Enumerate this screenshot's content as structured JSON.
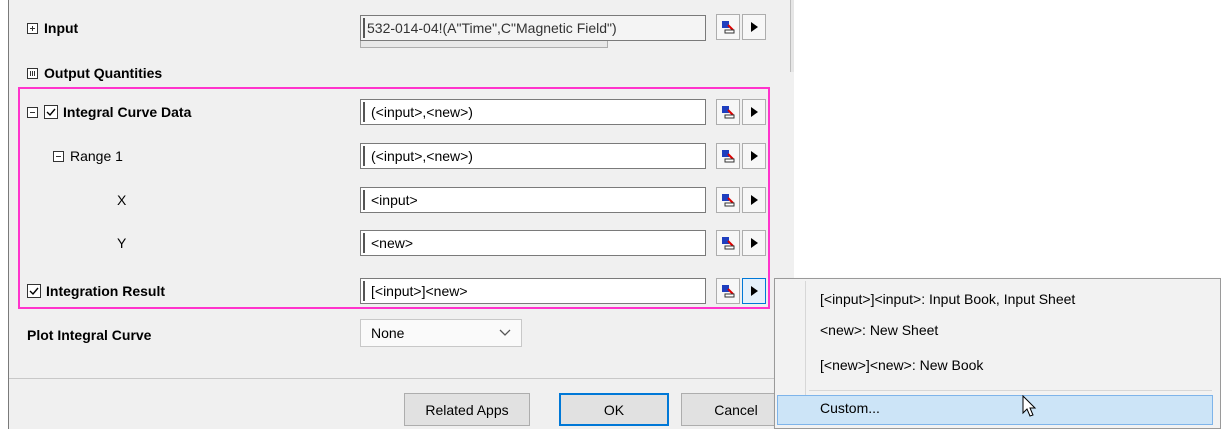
{
  "rows": {
    "input": {
      "label": "Input",
      "value": "532-014-04!(A\"Time\",C\"Magnetic Field\")"
    },
    "output_quantities": {
      "label": "Output Quantities"
    },
    "integral_curve": {
      "label": "Integral Curve Data",
      "value": "(<input>,<new>)",
      "checked": true
    },
    "range1": {
      "label": "Range 1",
      "value": "(<input>,<new>)"
    },
    "x": {
      "label": "X",
      "value": "<input>"
    },
    "y": {
      "label": "Y",
      "value": "<new>"
    },
    "integration_result": {
      "label": "Integration Result",
      "value": "[<input>]<new>",
      "checked": true
    },
    "plot_integral_curve": {
      "label": "Plot Integral Curve",
      "value": "None"
    }
  },
  "buttons": {
    "related_apps": "Related Apps",
    "ok": "OK",
    "cancel": "Cancel"
  },
  "menu": {
    "items": [
      "[<input>]<input>: Input Book, Input Sheet",
      "<new>: New Sheet",
      "[<new>]<new>: New Book",
      "Custom..."
    ],
    "highlighted_index": 3
  },
  "icons": {
    "expand": "plus-box-icon",
    "collapse": "minus-box-icon",
    "checkbox": "checkmark-icon",
    "select_range": "range-select-icon",
    "arrow": "triangle-right-icon",
    "dropdown": "chevron-down-icon",
    "cursor": "mouse-pointer-icon"
  },
  "colors": {
    "highlight_border": "#ff33cc",
    "menu_highlight": "#cce4f7",
    "default_button_border": "#0078d7"
  }
}
